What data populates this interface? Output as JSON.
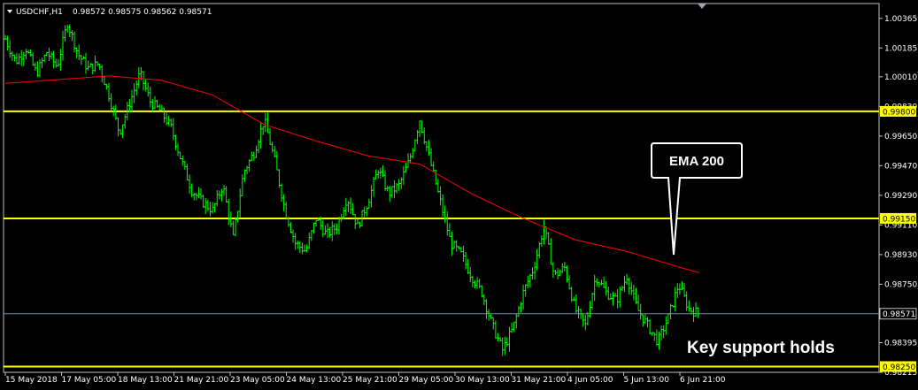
{
  "chart_data": {
    "type": "ohlc-bar",
    "header": {
      "symbol_timeframe": "USDCHF,H1",
      "ohlc_text": "0.98572 0.98575 0.98562 0.98571"
    },
    "ylim": [
      0.98215,
      1.00455
    ],
    "y_ticks": [
      "1.00365",
      "1.00185",
      "1.00010",
      "0.99830",
      "0.99650",
      "0.99470",
      "0.99290",
      "0.99110",
      "0.98930",
      "0.98750",
      "0.98395",
      "0.98215"
    ],
    "x_ticks": [
      "15 May 2018",
      "17 May 05:00",
      "18 May 13:00",
      "21 May 21:00",
      "23 May 05:00",
      "24 May 13:00",
      "25 May 21:00",
      "29 May 05:00",
      "30 May 13:00",
      "31 May 21:00",
      "4 Jun 05:00",
      "5 Jun 13:00",
      "6 Jun 21:00"
    ],
    "horizontal_levels": [
      {
        "price": 0.998,
        "label": "0.99800",
        "color": "#ffff00"
      },
      {
        "price": 0.9915,
        "label": "0.99150",
        "color": "#ffff00"
      },
      {
        "price": 0.9825,
        "label": "0.98250",
        "color": "#ffff00"
      }
    ],
    "current_price": {
      "price": 0.98571,
      "label": "0.98571",
      "color": "#6a8caf"
    },
    "price_series_color": "#00ff00",
    "price_path": [
      [
        0,
        1.0024
      ],
      [
        3,
        1.001
      ],
      [
        6,
        1.0018
      ],
      [
        9,
        1.0003
      ],
      [
        12,
        1.0016
      ],
      [
        15,
        1.0007
      ],
      [
        18,
        1.0034
      ],
      [
        21,
        1.0015
      ],
      [
        24,
        1.0006
      ],
      [
        27,
        1.0009
      ],
      [
        30,
        0.999
      ],
      [
        33,
        0.9967
      ],
      [
        36,
        0.9985
      ],
      [
        39,
        1.0003
      ],
      [
        42,
        0.9986
      ],
      [
        45,
        0.998
      ],
      [
        48,
        0.997
      ],
      [
        51,
        0.995
      ],
      [
        54,
        0.9932
      ],
      [
        57,
        0.9925
      ],
      [
        60,
        0.992
      ],
      [
        63,
        0.9935
      ],
      [
        66,
        0.9903
      ],
      [
        69,
        0.9943
      ],
      [
        72,
        0.9955
      ],
      [
        75,
        0.9975
      ],
      [
        78,
        0.995
      ],
      [
        81,
        0.992
      ],
      [
        84,
        0.99
      ],
      [
        87,
        0.9895
      ],
      [
        90,
        0.9915
      ],
      [
        93,
        0.9905
      ],
      [
        96,
        0.991
      ],
      [
        99,
        0.9928
      ],
      [
        102,
        0.991
      ],
      [
        105,
        0.9925
      ],
      [
        108,
        0.9945
      ],
      [
        111,
        0.993
      ],
      [
        114,
        0.9935
      ],
      [
        117,
        0.995
      ],
      [
        120,
        0.9975
      ],
      [
        123,
        0.995
      ],
      [
        126,
        0.9925
      ],
      [
        129,
        0.99
      ],
      [
        132,
        0.9893
      ],
      [
        135,
        0.988
      ],
      [
        138,
        0.987
      ],
      [
        141,
        0.985
      ],
      [
        144,
        0.9835
      ],
      [
        147,
        0.9848
      ],
      [
        150,
        0.987
      ],
      [
        153,
        0.9885
      ],
      [
        156,
        0.991
      ],
      [
        159,
        0.988
      ],
      [
        162,
        0.9885
      ],
      [
        165,
        0.986
      ],
      [
        168,
        0.985
      ],
      [
        171,
        0.988
      ],
      [
        174,
        0.987
      ],
      [
        177,
        0.9865
      ],
      [
        180,
        0.988
      ],
      [
        183,
        0.986
      ],
      [
        186,
        0.985
      ],
      [
        189,
        0.984
      ],
      [
        192,
        0.9855
      ],
      [
        195,
        0.9875
      ],
      [
        198,
        0.986
      ],
      [
        201,
        0.9857
      ]
    ],
    "ema": {
      "label": "EMA 200",
      "color": "#ff0000",
      "points": [
        [
          0,
          0.9997
        ],
        [
          30,
          1.00015
        ],
        [
          45,
          0.9999
        ],
        [
          60,
          0.999
        ],
        [
          75,
          0.9972
        ],
        [
          90,
          0.9962
        ],
        [
          105,
          0.9953
        ],
        [
          120,
          0.9948
        ],
        [
          135,
          0.993
        ],
        [
          150,
          0.9915
        ],
        [
          165,
          0.9902
        ],
        [
          180,
          0.9895
        ],
        [
          195,
          0.98855
        ],
        [
          201,
          0.9882
        ]
      ]
    },
    "annotations": [
      "EMA 200",
      "Key support holds"
    ]
  }
}
